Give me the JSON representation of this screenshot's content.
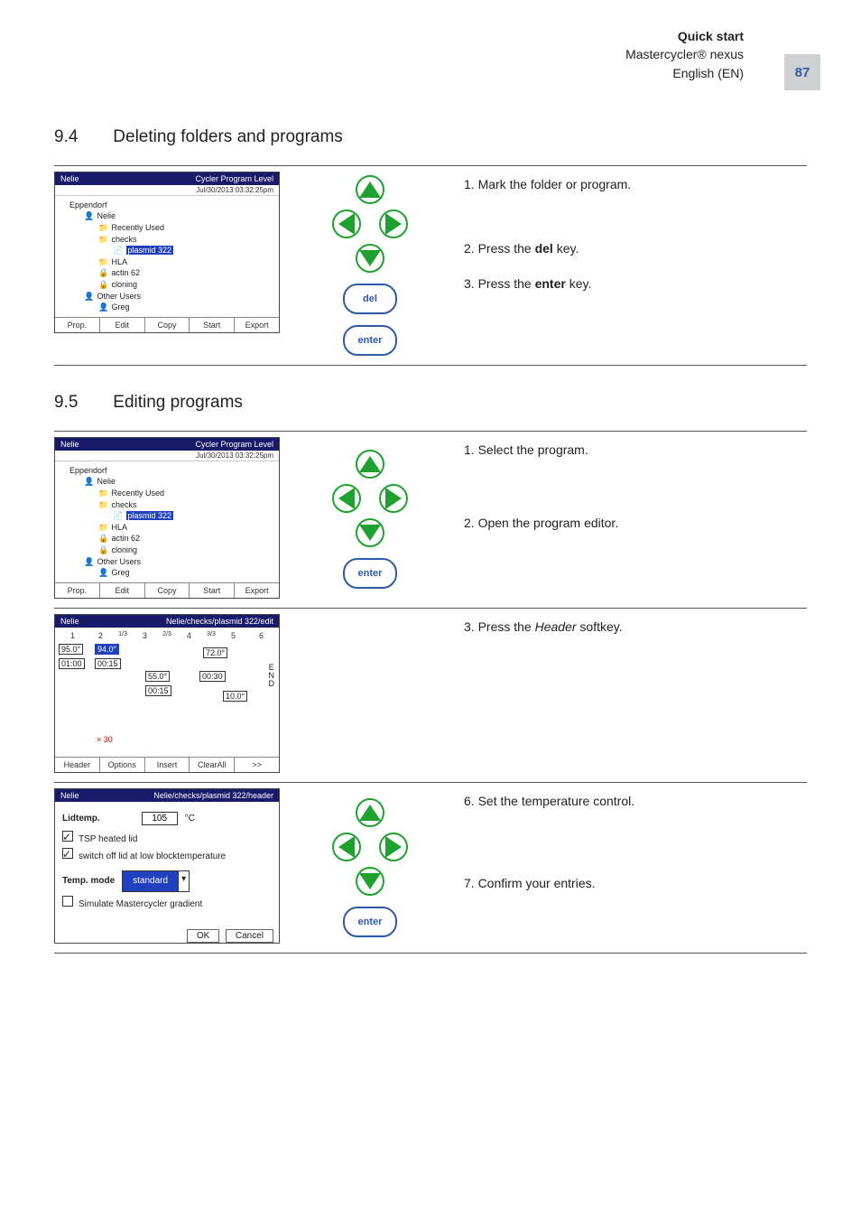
{
  "header": {
    "quick_start": "Quick start",
    "product": "Mastercycler® nexus",
    "lang": "English (EN)",
    "page": "87"
  },
  "s94": {
    "num": "9.4",
    "title": "Deleting folders and programs"
  },
  "s95": {
    "num": "9.5",
    "title": "Editing programs"
  },
  "instr": {
    "mark": "1. Mark the folder or program.",
    "press_del_a": "2. Press the ",
    "press_del_b": "del",
    "press_del_c": " key.",
    "press_enter_a": "3. Press the ",
    "press_enter_b": "enter",
    "press_enter_c": " key.",
    "select_prog": "1. Select the program.",
    "open_editor": "2. Open the program editor.",
    "press_header_a": "3. Press the ",
    "press_header_b": "Header",
    "press_header_c": " softkey.",
    "set_temp": "6. Set the temperature control.",
    "confirm": "7. Confirm your entries."
  },
  "btn": {
    "del": "del",
    "enter": "enter"
  },
  "tree_shot": {
    "title_left": "Nelie",
    "title_right": "Cycler Program Level",
    "timestamp": "Jul/30/2013 03:32:25pm",
    "root": "Eppendorf",
    "nelie": "Nelie",
    "recent": "Recently Used",
    "checks": "checks",
    "plasmid": "plasmid 322",
    "hla": "HLA",
    "actin": "actin 62",
    "cloning": "cloning",
    "other": "Other Users",
    "greg": "Greg",
    "softkeys": [
      "Prop.",
      "Edit",
      "Copy",
      "Start",
      "Export"
    ]
  },
  "editor_shot": {
    "title_right": "Nelie/checks/plasmid 322/edit",
    "cols": [
      "1",
      "2",
      "3",
      "4",
      "5",
      "6"
    ],
    "t95": "95.0°",
    "t94": "94.0°",
    "t72": "72.0°",
    "t55": "55.0°",
    "t10": "10.0°",
    "d0100": "01:00",
    "d0015a": "00:15",
    "d0030": "00:30",
    "d0015b": "00:15",
    "cycles": "× 30",
    "x13": "1/3",
    "x23": "2/3",
    "x33": "3/3",
    "end": "END",
    "softkeys": [
      "Header",
      "Options",
      "Insert",
      "ClearAll",
      ">>"
    ]
  },
  "header_shot": {
    "title_right": "Nelie/checks/plasmid 322/header",
    "lidtemp_label": "Lidtemp.",
    "lidtemp_value": "105",
    "deg": "°C",
    "tsp": "TSP heated lid",
    "switchoff": "switch off lid at low blocktemperature",
    "tempmode_label": "Temp. mode",
    "tempmode_value": "standard",
    "simulate": "Simulate Mastercycler gradient",
    "ok": "OK",
    "cancel": "Cancel"
  }
}
